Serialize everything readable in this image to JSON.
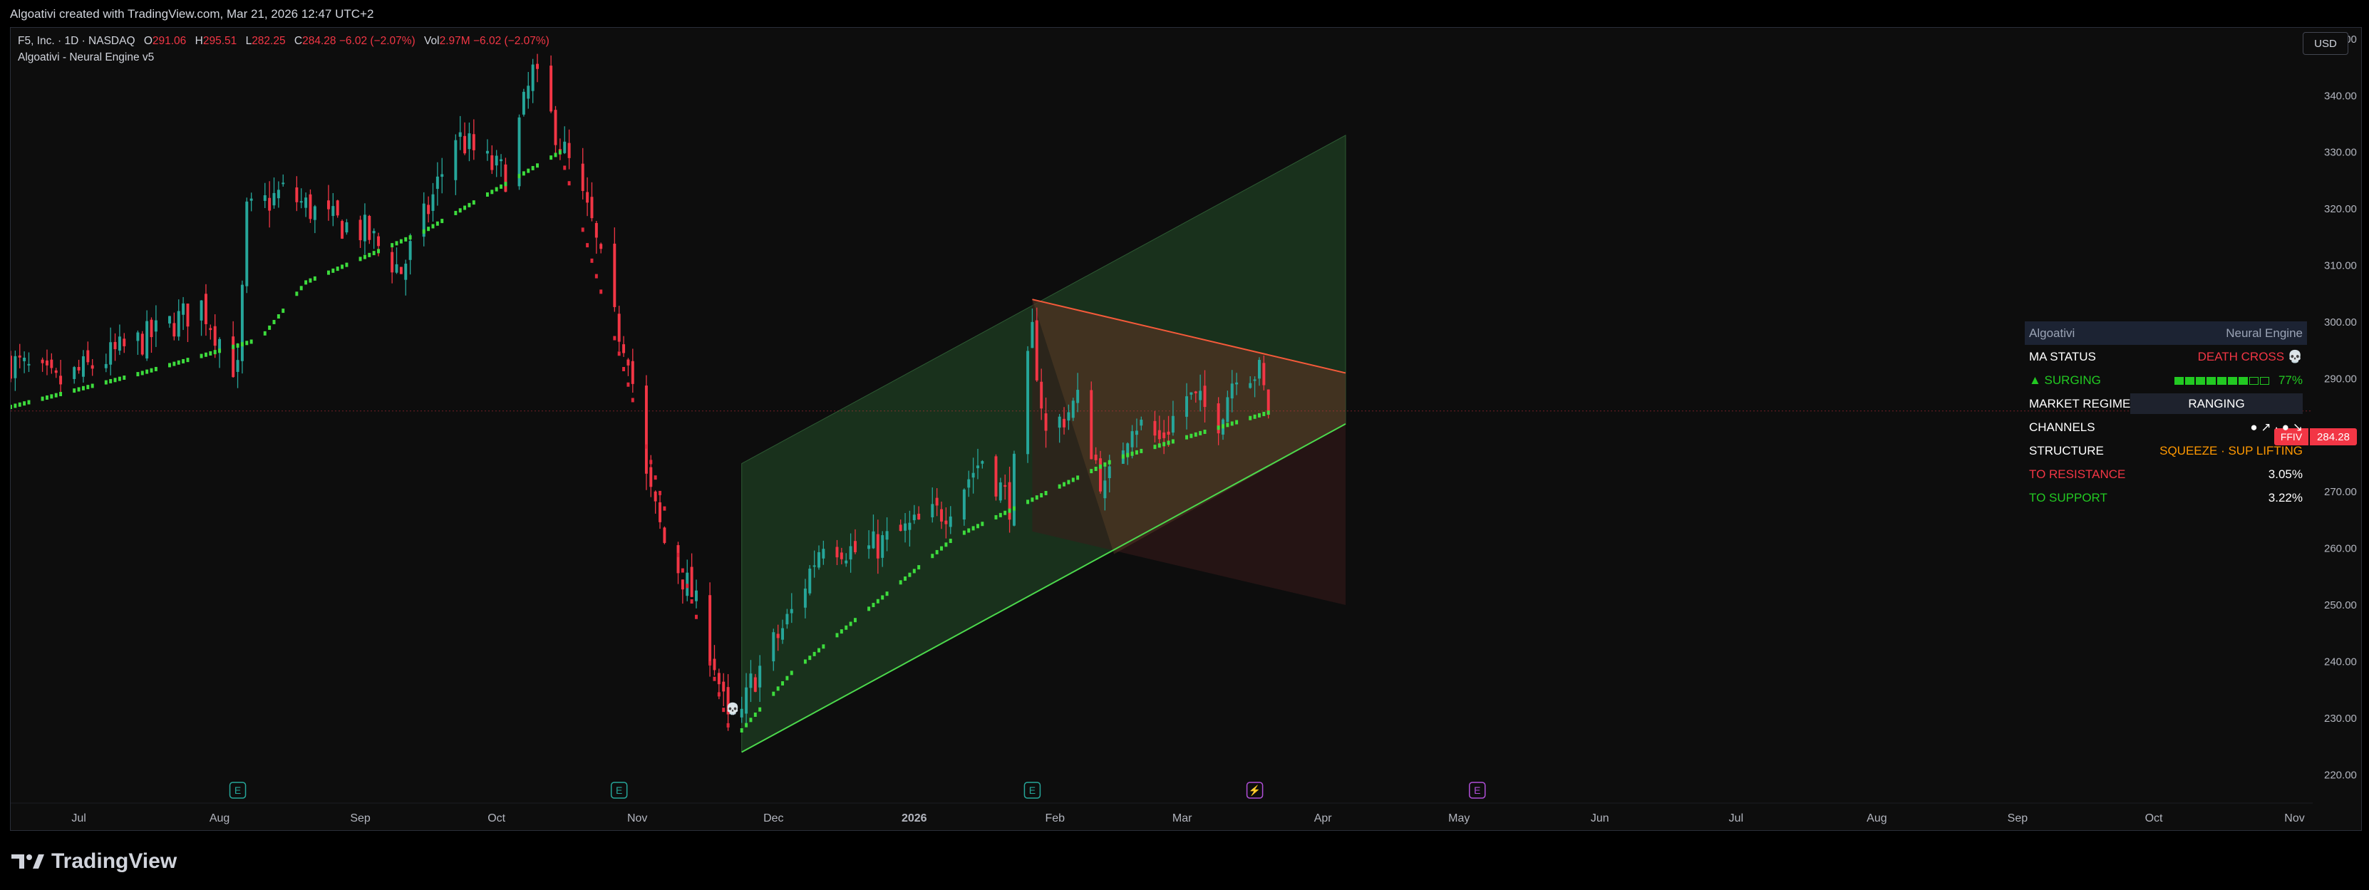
{
  "header": {
    "title": "Algoativi created with TradingView.com, Mar 21, 2026 12:47 UTC+2"
  },
  "legend": {
    "symbol": "F5, Inc. · 1D · NASDAQ",
    "o_label": "O",
    "o_val": "291.06",
    "h_label": "H",
    "h_val": "295.51",
    "l_label": "L",
    "l_val": "282.25",
    "c_label": "C",
    "c_val": "284.28 −6.02 (−2.07%)",
    "vol_label": "Vol",
    "vol_val": "2.97M −6.02 (−2.07%)",
    "indicator": "Algoativi - Neural Engine v5"
  },
  "currency_button": "USD",
  "price_tag": {
    "symbol": "FFIV",
    "value": "284.28"
  },
  "panel": {
    "header_left": "Algoativi",
    "header_right": "Neural Engine",
    "rows": [
      {
        "label": "MA STATUS",
        "value": "DEATH CROSS 💀",
        "label_color": "#ffffff",
        "value_color": "#f23645"
      },
      {
        "label": "▲ SURGING",
        "value": "77%",
        "label_color": "#22c922",
        "value_color": "#22c922",
        "bars": 7,
        "bars_total": 9
      },
      {
        "label": "MARKET REGIME",
        "value": "RANGING",
        "label_color": "#ffffff",
        "value_color": "#ffffff",
        "boxed": true
      },
      {
        "label": "CHANNELS",
        "value": "● ↗ ·  ● ↘",
        "label_color": "#ffffff",
        "value_color": "#ffffff"
      },
      {
        "label": "STRUCTURE",
        "value": "SQUEEZE · SUP LIFTING",
        "label_color": "#ffffff",
        "value_color": "#ff9800"
      },
      {
        "label": "TO RESISTANCE",
        "value": "3.05%",
        "label_color": "#f23645",
        "value_color": "#ffffff"
      },
      {
        "label": "TO SUPPORT",
        "value": "3.22%",
        "label_color": "#22c922",
        "value_color": "#ffffff"
      }
    ]
  },
  "footer": {
    "brand": "TradingView"
  },
  "colors": {
    "up": "#26a69a",
    "down": "#f23645",
    "ma": "#3ddc3d",
    "upper_channel": "#1e3d22",
    "lower_channel": "#3a1c1c",
    "resistance": "#f55a3a"
  },
  "chart_data": {
    "type": "candlestick",
    "title": "",
    "ylim": [
      215,
      352
    ],
    "y_ticks": [
      220,
      230,
      240,
      250,
      260,
      270,
      280,
      290,
      300,
      310,
      320,
      330,
      340,
      350
    ],
    "y_tick_labels": [
      "220.00",
      "230.00",
      "240.00",
      "250.00",
      "260.00",
      "270.00",
      "280.00",
      "290.00",
      "300.00",
      "310.00",
      "320.00",
      "330.00",
      "340.00",
      "350.00"
    ],
    "x_ticks": [
      "Jul",
      "Aug",
      "Sep",
      "Oct",
      "Nov",
      "Dec",
      "2026",
      "Feb",
      "Mar",
      "Apr",
      "May",
      "Jun",
      "Jul",
      "Aug",
      "Sep",
      "Oct",
      "Nov"
    ],
    "x_start": "2025-06-16",
    "x_end": "2026-11-05",
    "last_price": 284.28,
    "price_anchors": [
      [
        "2025-06-16",
        293
      ],
      [
        "2025-06-26",
        289
      ],
      [
        "2025-07-08",
        294
      ],
      [
        "2025-07-18",
        298
      ],
      [
        "2025-07-28",
        303
      ],
      [
        "2025-08-05",
        291
      ],
      [
        "2025-08-07",
        319
      ],
      [
        "2025-08-15",
        323
      ],
      [
        "2025-08-25",
        318
      ],
      [
        "2025-09-02",
        316
      ],
      [
        "2025-09-10",
        309
      ],
      [
        "2025-09-16",
        320
      ],
      [
        "2025-09-22",
        333
      ],
      [
        "2025-09-29",
        328
      ],
      [
        "2025-10-03",
        326
      ],
      [
        "2025-10-09",
        344
      ],
      [
        "2025-10-16",
        330
      ],
      [
        "2025-10-22",
        317
      ],
      [
        "2025-10-27",
        300
      ],
      [
        "2025-10-30",
        295
      ],
      [
        "2025-11-03",
        272
      ],
      [
        "2025-11-07",
        261
      ],
      [
        "2025-11-13",
        252
      ],
      [
        "2025-11-18",
        240
      ],
      [
        "2025-11-22",
        225
      ],
      [
        "2025-11-26",
        236
      ],
      [
        "2025-12-01",
        243
      ],
      [
        "2025-12-06",
        250
      ],
      [
        "2025-12-12",
        262
      ],
      [
        "2025-12-20",
        259
      ],
      [
        "2025-12-30",
        263
      ],
      [
        "2026-01-08",
        267
      ],
      [
        "2026-01-16",
        276
      ],
      [
        "2026-01-22",
        268
      ],
      [
        "2026-01-27",
        298
      ],
      [
        "2026-01-30",
        280
      ],
      [
        "2026-02-06",
        286
      ],
      [
        "2026-02-12",
        270
      ],
      [
        "2026-02-18",
        283
      ],
      [
        "2026-02-24",
        279
      ],
      [
        "2026-03-02",
        287
      ],
      [
        "2026-03-09",
        283
      ],
      [
        "2026-03-13",
        292
      ],
      [
        "2026-03-18",
        291
      ],
      [
        "2026-03-20",
        284.28
      ]
    ],
    "ma_anchors": [
      [
        "2025-06-16",
        285
      ],
      [
        "2025-07-15",
        291
      ],
      [
        "2025-08-10",
        297
      ],
      [
        "2025-08-20",
        307
      ],
      [
        "2025-09-15",
        316
      ],
      [
        "2025-10-15",
        330
      ],
      [
        "2025-11-22",
        226
      ],
      [
        "2025-12-05",
        238
      ],
      [
        "2026-01-10",
        262
      ],
      [
        "2026-02-15",
        276
      ],
      [
        "2026-03-20",
        284
      ]
    ],
    "channel_upper_band": {
      "start": [
        "2025-11-24",
        275
      ],
      "end": [
        "2026-04-06",
        333
      ]
    },
    "channel_support": {
      "start": [
        "2025-11-24",
        224
      ],
      "end": [
        "2026-04-06",
        282
      ]
    },
    "resistance_line": {
      "start": [
        "2026-01-27",
        304
      ],
      "end": [
        "2026-04-06",
        291
      ]
    },
    "lower_band": {
      "start": [
        "2026-01-27",
        263
      ],
      "end": [
        "2026-04-06",
        250
      ]
    },
    "event_markers": [
      {
        "date": "2025-08-05",
        "label": "E",
        "color": "#26a69a"
      },
      {
        "date": "2025-10-28",
        "label": "E",
        "color": "#26a69a"
      },
      {
        "date": "2026-01-27",
        "label": "E",
        "color": "#26a69a"
      },
      {
        "date": "2026-03-17",
        "label": "⚡",
        "color": "#b04fd8"
      },
      {
        "date": "2026-05-05",
        "label": "E",
        "color": "#b04fd8"
      }
    ],
    "skull_marker": {
      "date": "2025-11-22",
      "label": "💀"
    }
  }
}
